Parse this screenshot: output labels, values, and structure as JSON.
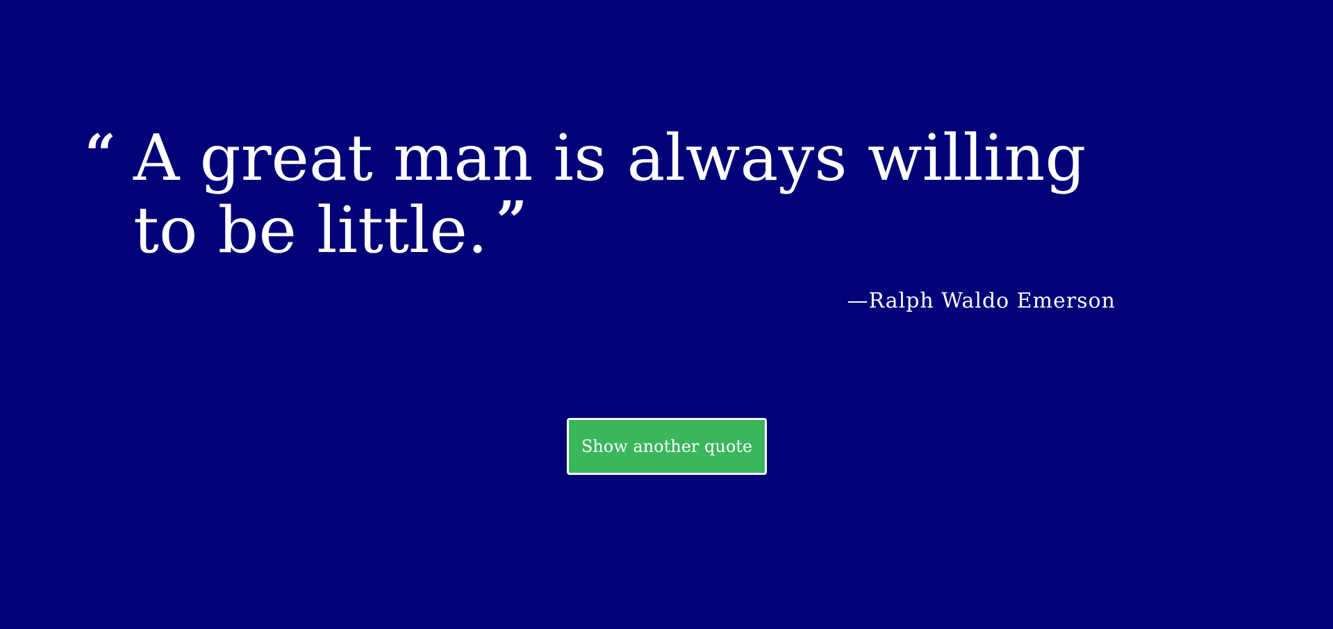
{
  "quote": {
    "open_mark": "“",
    "text": "A great man is always willing to be little.",
    "close_mark": "”",
    "author": "—Ralph Waldo Emerson"
  },
  "actions": {
    "next_label": "Show another quote"
  },
  "colors": {
    "background": "#010178",
    "button": "#3ab65d",
    "text": "#ffffff"
  }
}
